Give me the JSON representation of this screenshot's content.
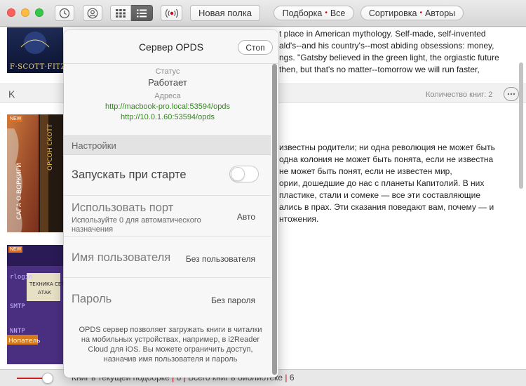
{
  "toolbar": {
    "new_shelf_label": "Новая полка",
    "selection_label": "Подборка",
    "selection_value": "Все",
    "sort_label": "Сортировка",
    "sort_value": "Авторы",
    "dot": "•"
  },
  "library": {
    "section_letter": "K",
    "books_count_label": "Количество книг: 2",
    "gatsby_cover_text": "F·SCOTT·FITZGE",
    "book1_description_lines": [
      "t place in American mythology. Self-made, self-invented",
      "ald's--and his country's--most abiding obsessions: money,",
      "ngs. \"Gatsby believed in the green light, the orgiastic future",
      "then, but that's no matter--tomorrow we will run faster,"
    ],
    "book2_description_lines": [
      "известны родители; ни одна революция не может быть",
      "одна колония не может быть понята, если не известна",
      "не может быть понят, если не известен мир,",
      "ории, дошедшие до нас с планеты Капитолий. В них",
      "пластике, стали и сомеке — все эти составляющие",
      "ались в прах.  Эти сказания поведают вам, почему — и",
      "нтожения."
    ],
    "new_badge": "NEW"
  },
  "statusbar": {
    "selection_books": "Книг в текущей подборке",
    "selection_count": "6",
    "library_books": "Всего книг в библиотеке",
    "library_count": "6",
    "separator": "|"
  },
  "popover": {
    "title": "Сервер OPDS",
    "stop_label": "Стоп",
    "status_label": "Статус",
    "status_value": "Работает",
    "address_label": "Адреса",
    "address_1": "http://macbook-pro.local:53594/opds",
    "address_2": "http://10.0.1.60:53594/opds",
    "settings_header": "Настройки",
    "launch_at_start_label": "Запускать при старте",
    "launch_at_start_on": false,
    "port_label": "Использовать порт",
    "port_hint": "Используйте 0 для автоматического назначения",
    "port_value": "Авто",
    "username_label": "Имя пользователя",
    "username_value": "Без пользователя",
    "password_label": "Пароль",
    "password_value": "Без пароля",
    "footer": "OPDS сервер позволяет загружать книги в читалки на мобильных устройствах, например, в i2Reader Cloud для iOS. Вы можете ограничить доступ, назначив имя пользователя и пароль"
  },
  "colors": {
    "accent_red": "#d0021b",
    "url_green": "#2e8a19",
    "slider_red": "#cc1f1f"
  },
  "icons": {
    "history": "clock-icon",
    "account": "person-circle-icon",
    "grid_view": "grid-icon",
    "list_view": "list-icon",
    "opds": "broadcast-icon"
  }
}
